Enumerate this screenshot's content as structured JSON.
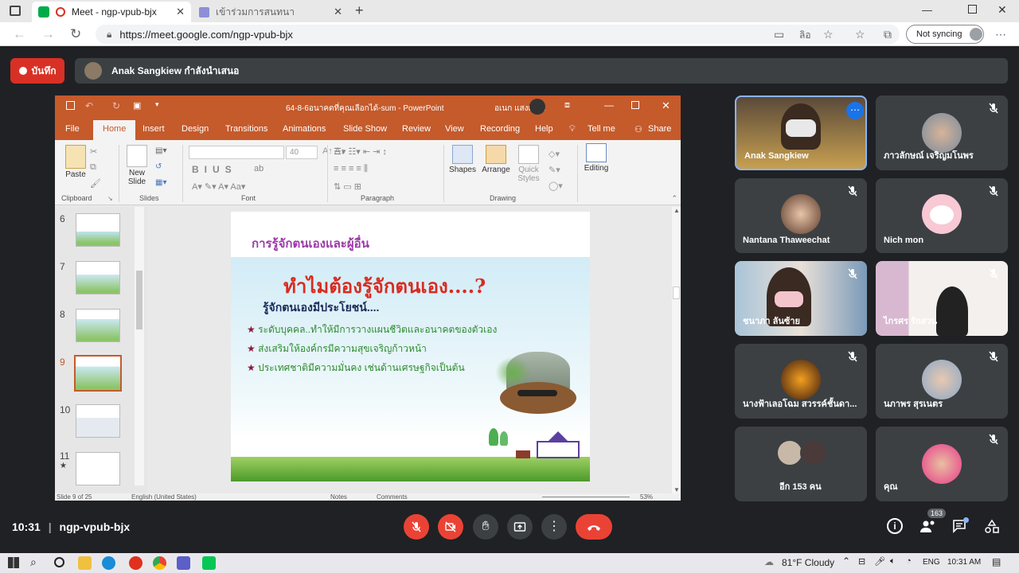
{
  "browser": {
    "tabs": [
      {
        "title": "Meet - ngp-vpub-bjx"
      },
      {
        "title": "เข้าร่วมการสนทนา"
      }
    ],
    "url": "https://meet.google.com/ngp-vpub-bjx",
    "translate_icon_text": "ลิอ",
    "sync_label": "Not syncing"
  },
  "meet": {
    "record_label": "บันทึก",
    "presenting_text": "Anak Sangkiew กำลังนำเสนอ",
    "time": "10:31",
    "meeting_code": "ngp-vpub-bjx",
    "people_count": "163"
  },
  "ppt": {
    "title": "64-8-6อนาคตที่คุณเลือกได้-sum - PowerPoint",
    "user": "อเนก แสงเขียว",
    "tabs": [
      "File",
      "Home",
      "Insert",
      "Design",
      "Transitions",
      "Animations",
      "Slide Show",
      "Review",
      "View",
      "Recording",
      "Help",
      "Tell me",
      "Share"
    ],
    "ribbon": {
      "paste": "Paste",
      "new_slide_1": "New",
      "new_slide_2": "Slide",
      "font_size": "40",
      "shapes": "Shapes",
      "arrange": "Arrange",
      "quick_1": "Quick",
      "quick_2": "Styles",
      "editing": "Editing",
      "groups": [
        "Clipboard",
        "Slides",
        "Font",
        "Paragraph",
        "Drawing"
      ]
    },
    "thumb_numbers": [
      "6",
      "7",
      "8",
      "9",
      "10",
      "11"
    ],
    "status": {
      "slide": "Slide 9 of 25",
      "language": "English (United States)",
      "notes": "Notes",
      "comments": "Comments",
      "zoom": "53%"
    },
    "slide": {
      "header": "การรู้จักตนเองและผู้อื่น",
      "title": "ทำไมต้องรู้จักตนเอง....?",
      "subtitle": "รู้จักตนเองมีประโยชน์....",
      "bullets": [
        "ระดับบุคคล..ทำให้มีการวางแผนชีวิตและอนาคตของตัวเอง",
        "ส่งเสริมให้องค์กรมีความสุขเจริญก้าวหน้า",
        "ประเทศชาติมีความมั่นคง เช่นด้านเศรษฐกิจเป็นต้น"
      ]
    }
  },
  "participants": [
    {
      "name": "Anak Sangkiew"
    },
    {
      "name": "ภาวลักษณ์ เจริญมโนพร"
    },
    {
      "name": "Nantana Thaweechat"
    },
    {
      "name": "Nich mon"
    },
    {
      "name": "ชนาภา ลันซ้าย"
    },
    {
      "name": "ไกรศร รักสวน"
    },
    {
      "name": "นางฟ้าเลอโฉม สวรรค์ชั้นดา..."
    },
    {
      "name": "นภาพร สุรเนตร"
    },
    {
      "name": "อีก 153 คน"
    },
    {
      "name": "คุณ"
    }
  ],
  "taskbar": {
    "weather": "81°F  Cloudy",
    "lang": "ENG",
    "time": "10:31 AM"
  },
  "colors": {
    "meet_bg": "#202124",
    "tile_bg": "#3c4043",
    "red": "#ea4335",
    "ppt_orange": "#c55a2b",
    "speaker_border": "#8ab4f8"
  }
}
